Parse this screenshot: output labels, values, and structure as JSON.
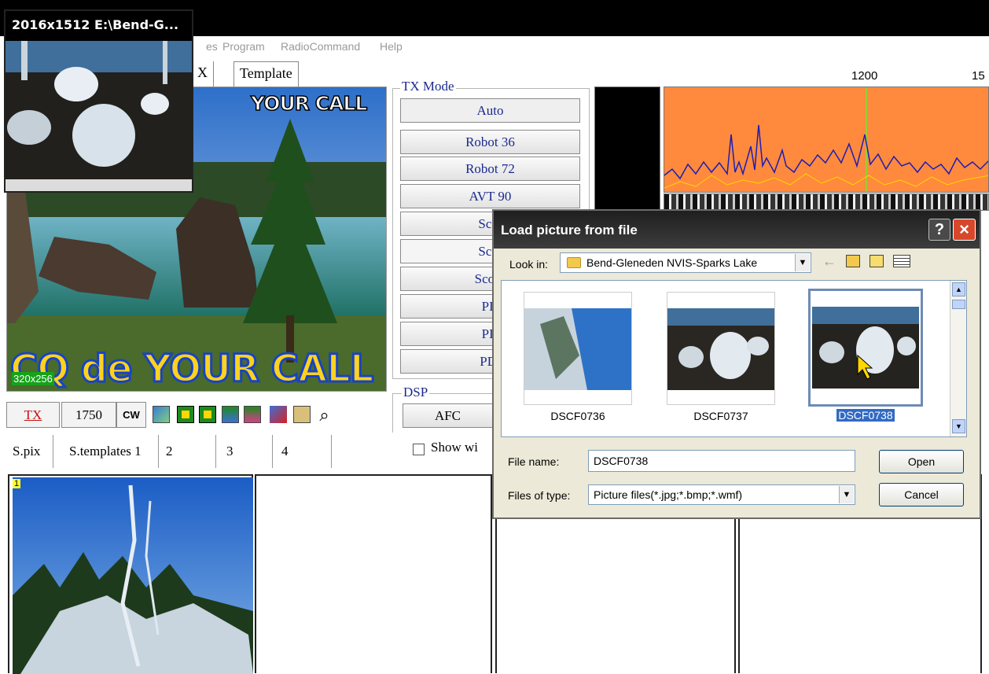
{
  "menu": {
    "items": [
      "es",
      "Program",
      "RadioCommand",
      "Help"
    ]
  },
  "tabs": {
    "partial": "X",
    "template": "Template"
  },
  "ruler": {
    "tick1": "1200",
    "tick2": "15"
  },
  "main_image": {
    "overlay_top": "YOUR CALL",
    "overlay_bottom": "CQ de YOUR CALL",
    "size_label": "320x256"
  },
  "tx_mode": {
    "label": "TX Mode",
    "buttons": [
      "Auto",
      "Robot 36",
      "Robot 72",
      "AVT 90",
      "Scot",
      "Scot",
      "Scotti",
      "PD",
      "PD",
      "PD:"
    ]
  },
  "dsp": {
    "label": "DSP",
    "afc": "AFC",
    "show_label": "Show wi"
  },
  "toolbar": {
    "tx": "TX",
    "freq": "1750",
    "cw": "CW"
  },
  "bottom_tabs": [
    "S.pix",
    "S.templates 1",
    "2",
    "3",
    "4"
  ],
  "gallery": {
    "first_badge": "1"
  },
  "float_window": {
    "title": "2016x1512 E:\\Bend-G..."
  },
  "dialog": {
    "title": "Load picture from file",
    "help": "?",
    "close": "×",
    "look_in_label": "Look in:",
    "look_in_value": "Bend-Gleneden NVIS-Sparks Lake",
    "thumbnails": [
      "DSCF0736",
      "DSCF0737",
      "DSCF0738"
    ],
    "file_name_label": "File name:",
    "file_name_value": "DSCF0738",
    "file_type_label": "Files of type:",
    "file_type_value": "Picture files(*.jpg;*.bmp;*.wmf)",
    "open": "Open",
    "cancel": "Cancel"
  },
  "colors": {
    "spectrum_bg": "#ff8a3d",
    "mode_text": "#1b2a8c",
    "selection": "#316ac5",
    "dialog_bg": "#ece9d8"
  }
}
